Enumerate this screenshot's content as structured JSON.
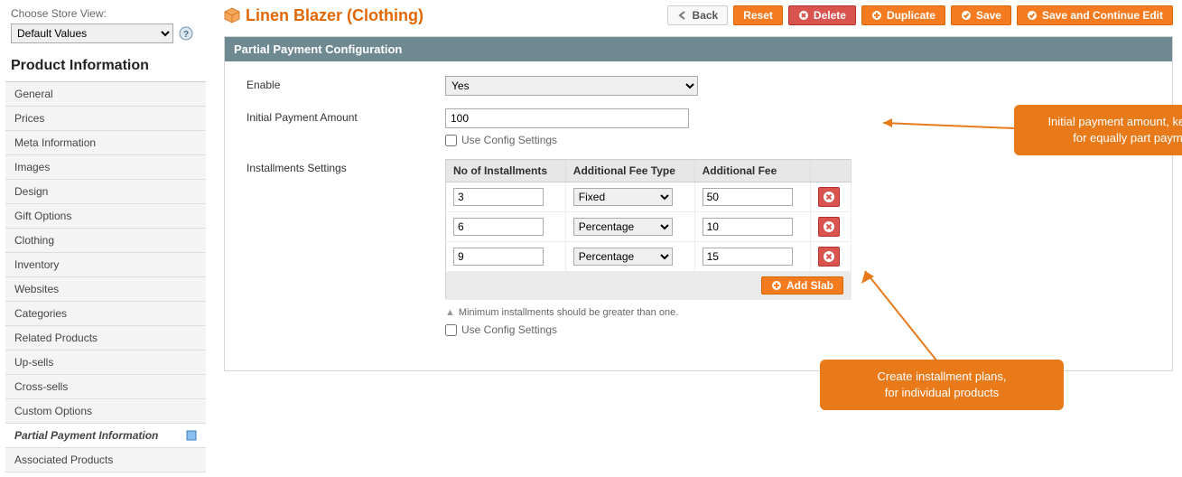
{
  "sidebar": {
    "store_label": "Choose Store View:",
    "store_value": "Default Values",
    "section_title": "Product Information",
    "items": [
      {
        "label": "General"
      },
      {
        "label": "Prices"
      },
      {
        "label": "Meta Information"
      },
      {
        "label": "Images"
      },
      {
        "label": "Design"
      },
      {
        "label": "Gift Options"
      },
      {
        "label": "Clothing"
      },
      {
        "label": "Inventory"
      },
      {
        "label": "Websites"
      },
      {
        "label": "Categories"
      },
      {
        "label": "Related Products"
      },
      {
        "label": "Up-sells"
      },
      {
        "label": "Cross-sells"
      },
      {
        "label": "Custom Options"
      },
      {
        "label": "Partial Payment Information",
        "active": true
      },
      {
        "label": "Associated Products"
      }
    ]
  },
  "header": {
    "title": "Linen Blazer (Clothing)",
    "buttons": {
      "back": "Back",
      "reset": "Reset",
      "delete": "Delete",
      "duplicate": "Duplicate",
      "save": "Save",
      "save_continue": "Save and Continue Edit"
    }
  },
  "panel": {
    "title": "Partial Payment Configuration",
    "enable": {
      "label": "Enable",
      "value": "Yes"
    },
    "initial": {
      "label": "Initial Payment Amount",
      "value": "100",
      "use_config": "Use Config Settings"
    },
    "installments": {
      "label": "Installments Settings",
      "columns": {
        "c1": "No of Installments",
        "c2": "Additional Fee Type",
        "c3": "Additional Fee"
      },
      "fee_type_options": [
        "Fixed",
        "Percentage"
      ],
      "rows": [
        {
          "n": "3",
          "type": "Fixed",
          "fee": "50"
        },
        {
          "n": "6",
          "type": "Percentage",
          "fee": "10"
        },
        {
          "n": "9",
          "type": "Percentage",
          "fee": "15"
        }
      ],
      "add_label": "Add Slab",
      "hint": "Minimum installments should be greater than one.",
      "use_config": "Use Config Settings"
    }
  },
  "callouts": {
    "c1_l1": "Initial payment amount, keep zero",
    "c1_l2": "for equally part payment",
    "c2_l1": "Create installment plans,",
    "c2_l2": "for individual products"
  }
}
